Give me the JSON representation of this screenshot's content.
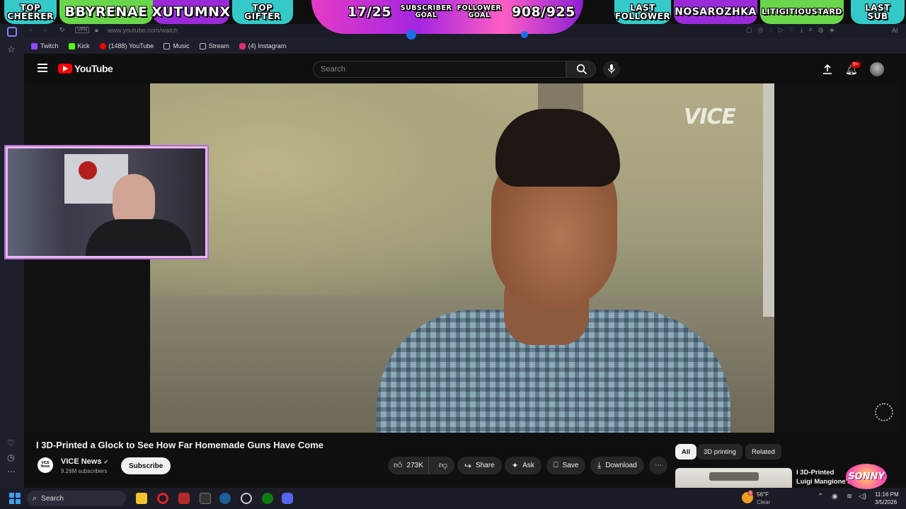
{
  "overlay": {
    "top_cheerer": "TOP\nCHEERER",
    "cheerer_name": "BBYRENAE",
    "gifter_name": "XUTUMNX",
    "top_gifter": "TOP\nGIFTER",
    "sub_count": "17/25",
    "sub_goal_label": "SUBSCRIBER\nGOAL",
    "follower_goal_label": "FOLLOWER\nGOAL",
    "follower_count": "908/925",
    "last_follower": "LAST\nFOLLOWER",
    "follower_name": "NOSAROZHKA",
    "sub_name": "LITIGITIOUSTARD",
    "last_sub": "LAST\nSUB",
    "colors": {
      "teal": "#35c9c9",
      "green": "#6ad64b",
      "purple": "#9a2ad8",
      "pink": "#e53bc6"
    }
  },
  "browser": {
    "url": "www.youtube.com/watch",
    "vpn_badge": "VPN",
    "bookmarks": [
      {
        "label": "Twitch",
        "icon": "twitch-icon",
        "color": "#9146ff"
      },
      {
        "label": "Kick",
        "icon": "kick-icon",
        "color": "#53fc18"
      },
      {
        "label": "(1488) YouTube",
        "icon": "youtube-icon",
        "color": "#ff0000"
      },
      {
        "label": "Music",
        "icon": "folder-icon",
        "color": "#bbbbbb"
      },
      {
        "label": "Stream",
        "icon": "folder-icon",
        "color": "#bbbbbb"
      },
      {
        "label": "(4) Instagram",
        "icon": "instagram-icon",
        "color": "#e1306c"
      }
    ]
  },
  "youtube": {
    "logo_text": "YouTube",
    "search_placeholder": "Search",
    "notification_badge": "9+",
    "video_watermark": "VICE",
    "title": "I 3D-Printed a Glock to See How Far Homemade Guns Have Come",
    "channel": {
      "avatar_text": "VICE\nNews",
      "name": "VICE News",
      "subscribers": "9.26M subscribers",
      "subscribe_label": "Subscribe"
    },
    "actions": {
      "likes": "273K",
      "share": "Share",
      "ask": "Ask",
      "save": "Save",
      "download": "Download"
    },
    "chips": [
      "All",
      "3D printing",
      "Related"
    ],
    "recommended": {
      "title": "I 3D-Printed Luigi Mangione's 'Ghost..."
    }
  },
  "stream_logo": "SONNY",
  "taskbar": {
    "search_label": "Search",
    "weather_temp": "56°F",
    "weather_desc": "Clear",
    "time": "11:16 PM",
    "date": "3/5/2026",
    "notif_count": "3"
  }
}
